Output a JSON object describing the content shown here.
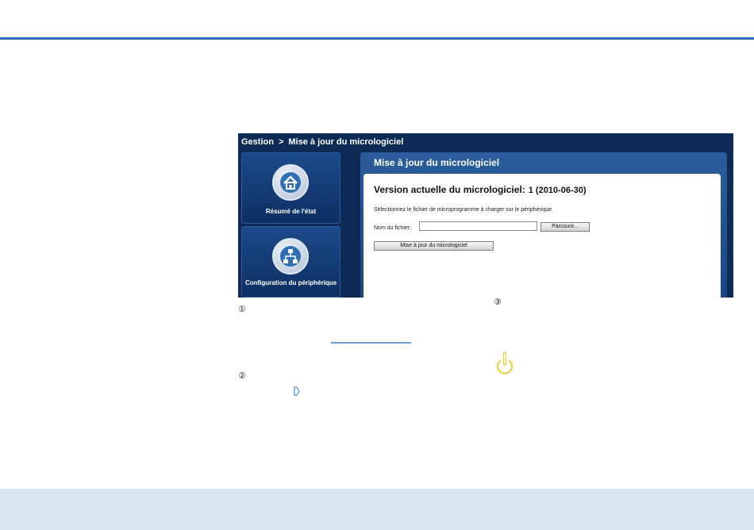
{
  "breadcrumb": {
    "root": "Gestion",
    "separator": ">",
    "current": "Mise à jour du micrologiciel"
  },
  "sidebar": {
    "items": [
      {
        "label": "Résumé de l'état",
        "icon": "home-icon"
      },
      {
        "label": "Configuration du périphérique",
        "icon": "network-icon"
      }
    ]
  },
  "panel": {
    "title": "Mise à jour du micrologiciel",
    "version_label": "Version actuelle du micrologiciel:",
    "version_value": "1 (2010-06-30)",
    "instruction": "Sélectionnez le fichier de microprogramme à charger sur le périphérique.",
    "file_label": "Nom du fichier:",
    "file_value": "",
    "browse_label": "Parcourir...",
    "update_label": "Mise à jour du micrologiciel"
  },
  "annotations": {
    "one": "①",
    "two": "②",
    "three": "③"
  },
  "colors": {
    "accent": "#2f6cc1",
    "footer": "#dce6f1",
    "panel_dark": "#0d2a55",
    "power_yellow": "#e8d050"
  }
}
